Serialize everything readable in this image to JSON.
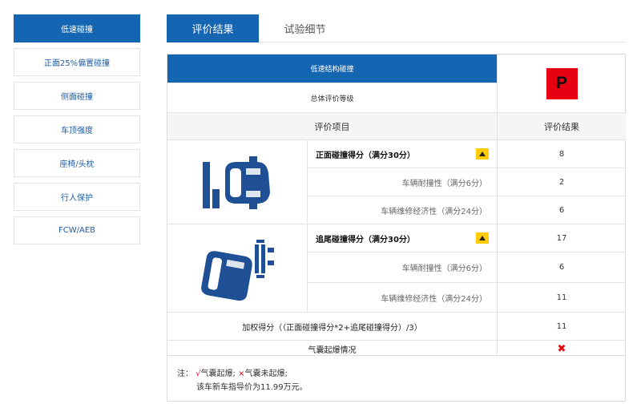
{
  "sidebar": {
    "items": [
      {
        "label": "低速碰撞",
        "active": true
      },
      {
        "label": "正面25%偏置碰撞"
      },
      {
        "label": "侧面碰撞"
      },
      {
        "label": "车顶强度"
      },
      {
        "label": "座椅/头枕"
      },
      {
        "label": "行人保护"
      },
      {
        "label": "FCW/AEB"
      }
    ]
  },
  "tabs": [
    {
      "label": "评价结果",
      "active": true
    },
    {
      "label": "试验细节"
    }
  ],
  "summary": {
    "section_title": "低速结构碰撞",
    "grade_label": "总体评价等级",
    "rating": "P",
    "rating_color": "#e60012"
  },
  "columns": {
    "items": "评价项目",
    "result": "评价结果"
  },
  "groups": [
    {
      "icon": "front-impact-diagram-icon",
      "main": {
        "label": "正面碰撞得分（满分30分）",
        "value": "8"
      },
      "subs": [
        {
          "label": "车辆耐撞性（满分6分）",
          "value": "2"
        },
        {
          "label": "车辆维修经济性（满分24分）",
          "value": "6"
        }
      ]
    },
    {
      "icon": "rear-impact-diagram-icon",
      "main": {
        "label": "追尾碰撞得分（满分30分）",
        "value": "17"
      },
      "subs": [
        {
          "label": "车辆耐撞性（满分6分）",
          "value": "6"
        },
        {
          "label": "车辆维修经济性（满分24分）",
          "value": "11"
        }
      ]
    }
  ],
  "weighted": {
    "label": "加权得分（（正面碰撞得分*2+追尾碰撞得分）/3）",
    "value": "11"
  },
  "airbag": {
    "label": "气囊起爆情况",
    "value": "✖"
  },
  "note": {
    "prefix": "注：",
    "check": "√",
    "check_text": "气囊起爆;",
    "cross": "×",
    "cross_text": "气囊未起爆;",
    "price": "该车新车指导价为11.99万元。"
  },
  "colors": {
    "primary": "#1465b2",
    "badge_red": "#e60012",
    "arrow_yellow": "#ffcc00"
  }
}
